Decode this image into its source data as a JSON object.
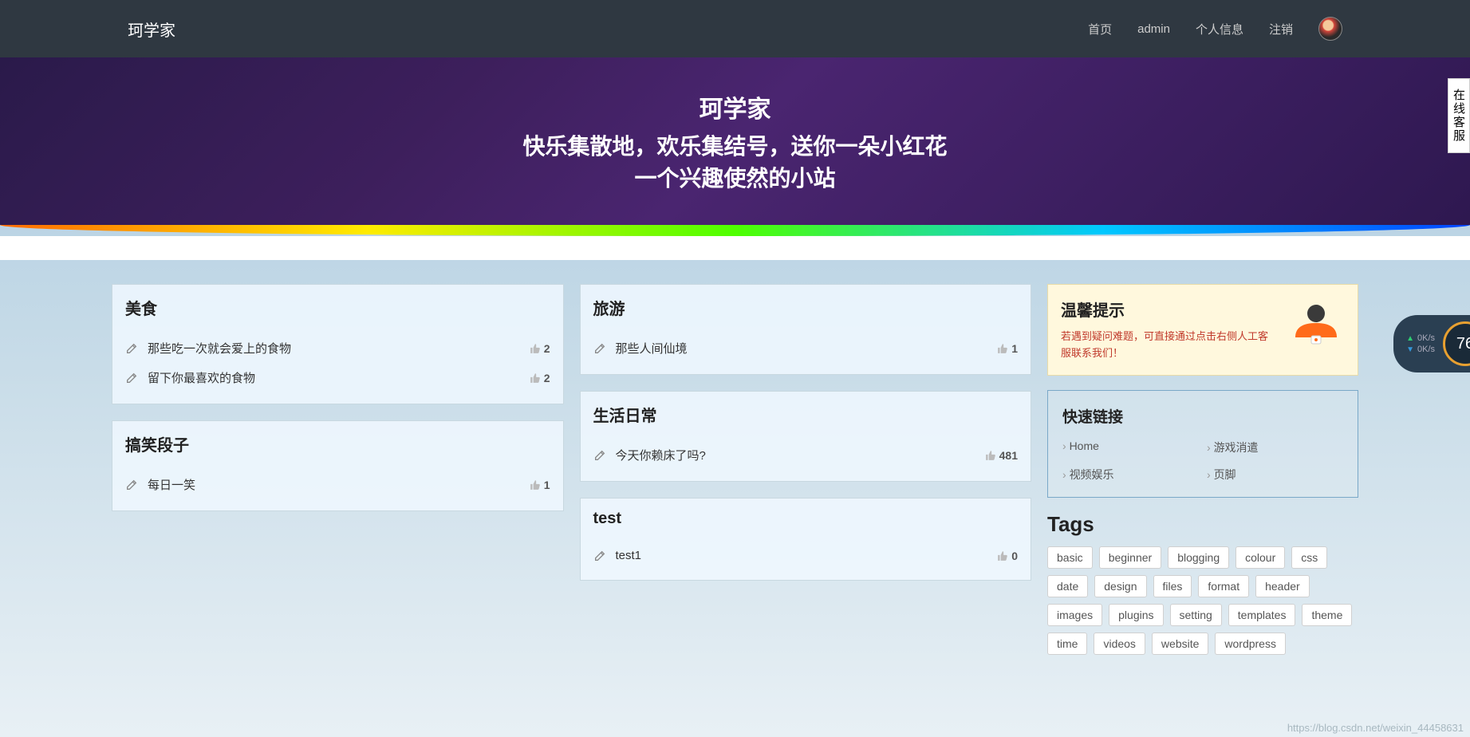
{
  "nav": {
    "brand": "珂学家",
    "links": [
      "首页",
      "admin",
      "个人信息",
      "注销"
    ]
  },
  "hero": {
    "line1": "珂学家",
    "line2": "快乐集散地，欢乐集结号，送你一朵小红花",
    "line3": "一个兴趣使然的小站"
  },
  "columns": [
    [
      {
        "title": "美食",
        "items": [
          {
            "text": "那些吃一次就会爱上的食物",
            "likes": "2"
          },
          {
            "text": "留下你最喜欢的食物",
            "likes": "2"
          }
        ]
      },
      {
        "title": "搞笑段子",
        "items": [
          {
            "text": "每日一笑",
            "likes": "1"
          }
        ]
      }
    ],
    [
      {
        "title": "旅游",
        "items": [
          {
            "text": "那些人间仙境",
            "likes": "1"
          }
        ]
      },
      {
        "title": "生活日常",
        "items": [
          {
            "text": "今天你赖床了吗?",
            "likes": "481"
          }
        ]
      },
      {
        "title": "test",
        "items": [
          {
            "text": "test1",
            "likes": "0"
          }
        ]
      }
    ]
  ],
  "tip": {
    "title": "温馨提示",
    "text": "若遇到疑问难题，可直接通过点击右侧人工客服联系我们！"
  },
  "quick": {
    "title": "快速链接",
    "links": [
      "Home",
      "游戏消遣",
      "视频娱乐",
      "页脚"
    ]
  },
  "tags": {
    "title": "Tags",
    "list": [
      "basic",
      "beginner",
      "blogging",
      "colour",
      "css",
      "date",
      "design",
      "files",
      "format",
      "header",
      "images",
      "plugins",
      "setting",
      "templates",
      "theme",
      "time",
      "videos",
      "website",
      "wordpress"
    ]
  },
  "sideWidget": "在线客服",
  "speed": {
    "up": "0K/s",
    "down": "0K/s",
    "val": "76"
  },
  "watermark": "https://blog.csdn.net/weixin_44458631"
}
